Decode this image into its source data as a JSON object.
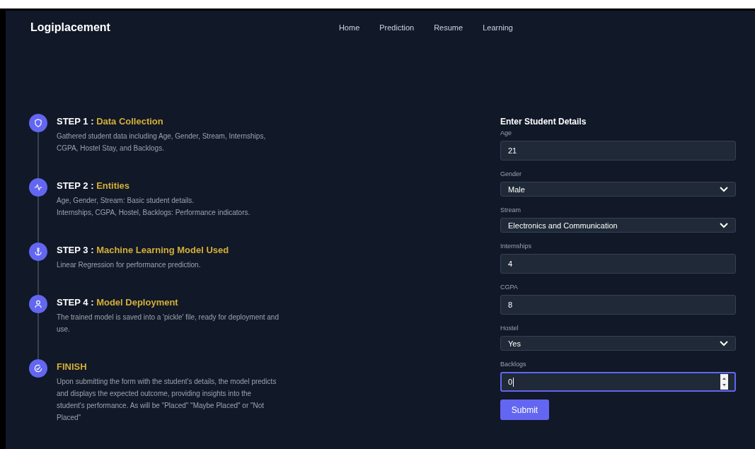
{
  "navbar": {
    "brand": "Logiplacement",
    "links": [
      "Home",
      "Prediction",
      "Resume",
      "Learning"
    ]
  },
  "steps": [
    {
      "label": "STEP 1 :",
      "title": "Data Collection",
      "lines": [
        "Gathered student data including Age, Gender, Stream, Internships, CGPA, Hostel Stay, and Backlogs."
      ]
    },
    {
      "label": "STEP 2 :",
      "title": "Entities",
      "lines": [
        "Age, Gender, Stream: Basic student details.",
        "Internships, CGPA, Hostel, Backlogs: Performance indicators."
      ]
    },
    {
      "label": "STEP 3 :",
      "title": "Machine Learning Model Used",
      "lines": [
        "Linear Regression for performance prediction."
      ]
    },
    {
      "label": "STEP 4 :",
      "title": "Model Deployment",
      "lines": [
        "The trained model is saved into a 'pickle' file, ready for deployment and use."
      ]
    },
    {
      "title": "FINISH",
      "lines": [
        "Upon submitting the form with the student's details, the model predicts and displays the expected outcome, providing insights into the student's performance. As will be \"Placed\" \"Maybe Placed\" or \"Not Placed\""
      ]
    }
  ],
  "form": {
    "heading": "Enter Student Details",
    "fields": [
      {
        "label": "Age",
        "kind": "text",
        "value": "21",
        "focused": false
      },
      {
        "label": "Gender",
        "kind": "select",
        "value": "Male",
        "focused": false
      },
      {
        "label": "Stream",
        "kind": "select",
        "value": "Electronics and Communication",
        "focused": false
      },
      {
        "label": "Internships",
        "kind": "text",
        "value": "4",
        "focused": false
      },
      {
        "label": "CGPA",
        "kind": "text",
        "value": "8",
        "focused": false
      },
      {
        "label": "Hostel",
        "kind": "select",
        "value": "Yes",
        "focused": false
      },
      {
        "label": "Backlogs",
        "kind": "number",
        "value": "0",
        "focused": true
      }
    ],
    "submit": "Submit"
  }
}
